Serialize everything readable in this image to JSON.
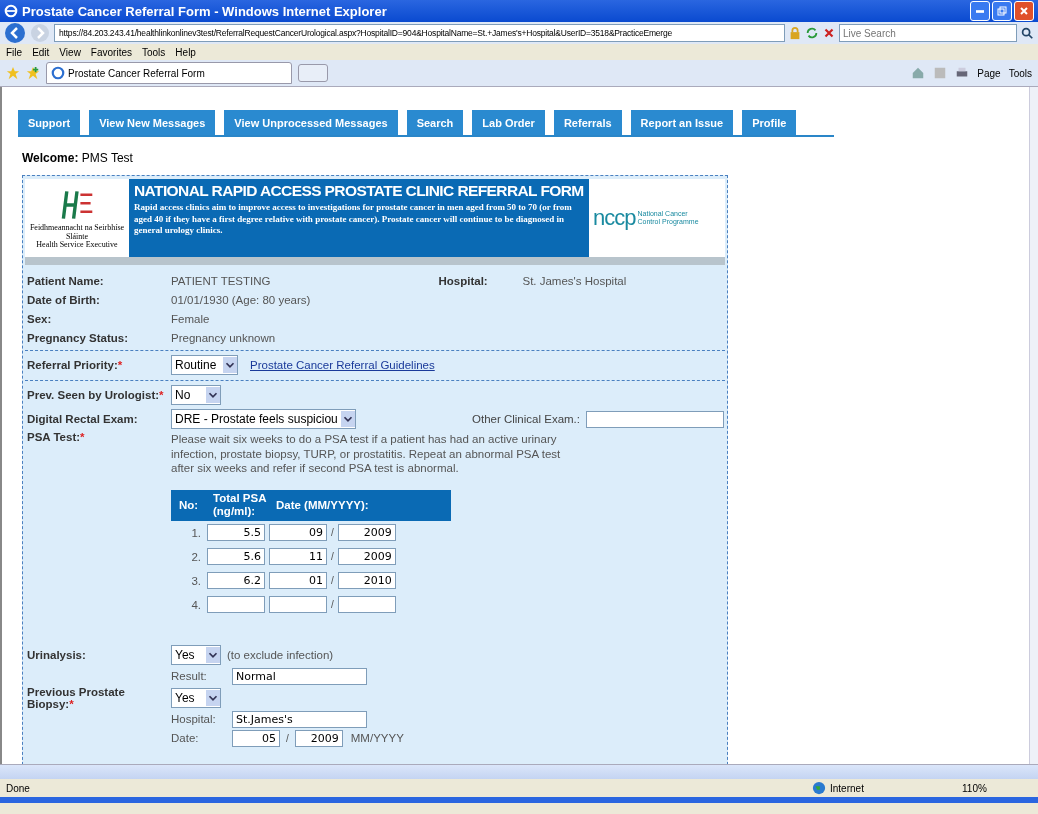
{
  "window": {
    "title": "Prostate Cancer Referral Form - Windows Internet Explorer"
  },
  "address_bar": {
    "url": "https://84.203.243.41/healthlinkonlinev3test/ReferralRequestCancerUrological.aspx?HospitalID=904&HospitalName=St.+James's+Hospital&UserID=3518&PracticeEmerge"
  },
  "search": {
    "placeholder": "Live Search"
  },
  "menu": [
    "File",
    "Edit",
    "View",
    "Favorites",
    "Tools",
    "Help"
  ],
  "browser_tab": {
    "title": "Prostate Cancer Referral Form"
  },
  "command_bar": [
    "Page",
    "Tools"
  ],
  "nav": [
    {
      "label": "Support"
    },
    {
      "label": "View New Messages"
    },
    {
      "label": "View Unprocessed Messages"
    },
    {
      "label": "Search"
    },
    {
      "label": "Lab Order"
    },
    {
      "label": "Referrals"
    },
    {
      "label": "Report an Issue"
    },
    {
      "label": "Profile"
    }
  ],
  "welcome": {
    "label": "Welcome:",
    "value": "PMS Test"
  },
  "banner": {
    "logo_caption": [
      "Feidhmeannacht na Seirbhíse Sláinte",
      "Health Service Executive"
    ],
    "title": "NATIONAL RAPID ACCESS PROSTATE CLINIC REFERRAL FORM",
    "text": "Rapid access clinics aim to improve access to investigations for prostate cancer in men aged from 50 to 70 (or from aged 40 if they have a first degree relative with prostate cancer). Prostate cancer will continue to be diagnosed in general urology clinics.",
    "partner_logo": "nccp",
    "partner_caption": [
      "National Cancer",
      "Control Programme"
    ]
  },
  "patient": [
    {
      "label": "Patient Name:",
      "value": "PATIENT TESTING"
    },
    {
      "label": "Date of Birth:",
      "value": "01/01/1930 (Age: 80 years)"
    },
    {
      "label": "Sex:",
      "value": "Female"
    },
    {
      "label": "Pregnancy Status:",
      "value": "Pregnancy unknown"
    }
  ],
  "hospital": {
    "label": "Hospital:",
    "value": "St. James's Hospital"
  },
  "referral_priority": {
    "label": "Referral Priority:",
    "required_mark": "*",
    "value": "Routine",
    "link": "Prostate Cancer Referral Guidelines"
  },
  "prev_seen": {
    "label": "Prev. Seen by Urologist:",
    "required_mark": "*",
    "value": "No"
  },
  "dre": {
    "label": "Digital Rectal Exam:",
    "value": "DRE - Prostate feels suspiciou",
    "other_label": "Other Clinical Exam.:"
  },
  "psa": {
    "label": "PSA Test:",
    "required_mark": "*",
    "note": "Please wait six weeks to do a PSA test if a patient has had an active urinary infection, prostate biopsy, TURP, or prostatitis. Repeat an abnormal PSA test after six weeks and refer if second PSA test is abnormal.",
    "columns": [
      "No:",
      "Total PSA (ng/ml):",
      "Date (MM/YYYY):"
    ],
    "rows": [
      {
        "no": "1.",
        "psa": "5.5",
        "month": "09",
        "separator": "/",
        "year": "2009"
      },
      {
        "no": "2.",
        "psa": "5.6",
        "month": "11",
        "separator": "/",
        "year": "2009"
      },
      {
        "no": "3.",
        "psa": "6.2",
        "month": "01",
        "separator": "/",
        "year": "2010"
      },
      {
        "no": "4.",
        "separator": "/"
      }
    ]
  },
  "urinalysis": {
    "label": "Urinalysis:",
    "value": "Yes",
    "note": "(to exclude infection)",
    "result_label": "Result:",
    "result": "Normal"
  },
  "biopsy": {
    "label": "Previous Prostate Biopsy:",
    "required_mark": "*",
    "value": "Yes",
    "hospital_label": "Hospital:",
    "hospital": "St.James's",
    "date_label": "Date:",
    "month": "05",
    "separator": "/",
    "year": "2009",
    "format": "MM/YYYY"
  },
  "status_bar": {
    "text": "Done",
    "zone": "Internet",
    "zoom": "110%"
  }
}
